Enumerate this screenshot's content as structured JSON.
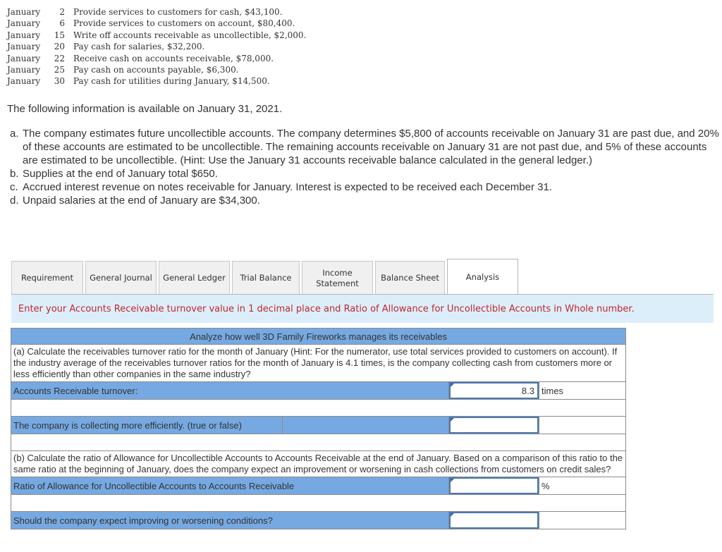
{
  "transactions": [
    {
      "month": "January",
      "day": "2",
      "text": "Provide services to customers for cash, $43,100."
    },
    {
      "month": "January",
      "day": "6",
      "text": "Provide services to customers on account, $80,400."
    },
    {
      "month": "January",
      "day": "15",
      "text": "Write off accounts receivable as uncollectible, $2,000."
    },
    {
      "month": "January",
      "day": "20",
      "text": "Pay cash for salaries, $32,200."
    },
    {
      "month": "January",
      "day": "22",
      "text": "Receive cash on accounts receivable, $78,000."
    },
    {
      "month": "January",
      "day": "25",
      "text": "Pay cash on accounts payable, $6,300."
    },
    {
      "month": "January",
      "day": "30",
      "text": "Pay cash for utilities during January, $14,500."
    }
  ],
  "info": {
    "heading": "The following information is available on January 31, 2021.",
    "items": [
      {
        "label": "a.",
        "text": "The company estimates future uncollectible accounts. The company determines $5,800 of accounts receivable on January 31 are past due, and 20% of these accounts are estimated to be uncollectible. The remaining accounts receivable on January 31 are not past due, and 5% of these accounts are estimated to be uncollectible. (Hint: Use the January 31 accounts receivable balance calculated in the general ledger.)"
      },
      {
        "label": "b.",
        "text": "Supplies at the end of January total $650."
      },
      {
        "label": "c.",
        "text": "Accrued interest revenue on notes receivable for January. Interest is expected to be received each December 31."
      },
      {
        "label": "d.",
        "text": "Unpaid salaries at the end of January are $34,300."
      }
    ]
  },
  "tabs": [
    {
      "label": "Requirement",
      "active": false
    },
    {
      "label": "General Journal",
      "active": false
    },
    {
      "label": "General Ledger",
      "active": false
    },
    {
      "label": "Trial Balance",
      "active": false
    },
    {
      "label": "Income Statement",
      "active": false
    },
    {
      "label": "Balance Sheet",
      "active": false
    },
    {
      "label": "Analysis",
      "active": true
    }
  ],
  "notice": "Enter your Accounts Receivable turnover value in 1 decimal place and Ratio of Allowance for Uncollectible Accounts in Whole number.",
  "analysis": {
    "title": "Analyze how well 3D Family Fireworks manages its receivables",
    "part_a": {
      "question": "(a) Calculate the receivables turnover ratio for the month of January (Hint: For the numerator, use total services provided to customers on account). If the industry average of the receivables turnover ratios for the month of January is 4.1 times, is the company collecting cash from customers more or less efficiently than other companies in the same industry?",
      "turnover_label": "Accounts Receivable turnover:",
      "turnover_value": "8.3",
      "turnover_unit": "times",
      "efficiency_label": "The company is collecting more efficiently. (true or false)",
      "efficiency_value": ""
    },
    "part_b": {
      "question": "(b) Calculate the ratio of Allowance for Uncollectible Accounts to Accounts Receivable at the end of January. Based on a comparison of this ratio to the same ratio at the beginning of January, does the company expect an improvement or worsening in cash collections from customers on credit sales?",
      "ratio_label": "Ratio of Allowance for Uncollectible Accounts to Accounts Receivable",
      "ratio_value": "",
      "ratio_unit": "%",
      "conditions_label": "Should the company expect improving or worsening conditions?",
      "conditions_value": ""
    }
  }
}
